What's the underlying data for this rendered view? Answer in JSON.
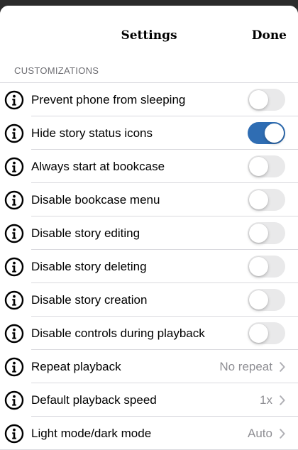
{
  "nav": {
    "title": "Settings",
    "done_label": "Done"
  },
  "section": {
    "header": "CUSTOMIZATIONS"
  },
  "colors": {
    "toggle_on": "#2f6db3",
    "toggle_off": "#e9e9ea",
    "value_text": "#8e8e93"
  },
  "rows": [
    {
      "label": "Prevent phone from sleeping",
      "type": "toggle",
      "on": false
    },
    {
      "label": "Hide story status icons",
      "type": "toggle",
      "on": true
    },
    {
      "label": "Always start at bookcase",
      "type": "toggle",
      "on": false
    },
    {
      "label": "Disable bookcase menu",
      "type": "toggle",
      "on": false
    },
    {
      "label": "Disable story editing",
      "type": "toggle",
      "on": false
    },
    {
      "label": "Disable story deleting",
      "type": "toggle",
      "on": false
    },
    {
      "label": "Disable story creation",
      "type": "toggle",
      "on": false
    },
    {
      "label": "Disable controls during playback",
      "type": "toggle",
      "on": false
    },
    {
      "label": "Repeat playback",
      "type": "value",
      "value": "No repeat"
    },
    {
      "label": "Default playback speed",
      "type": "value",
      "value": "1x"
    },
    {
      "label": "Light mode/dark mode",
      "type": "value",
      "value": "Auto"
    }
  ]
}
